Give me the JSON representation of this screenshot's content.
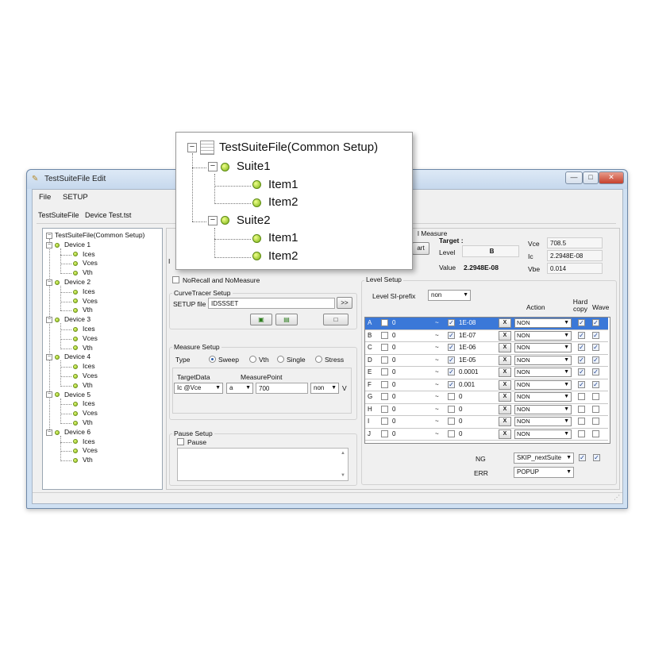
{
  "window": {
    "title": "TestSuiteFile Edit",
    "controls": {
      "minimize": "—",
      "maximize": "□",
      "close": "✕"
    }
  },
  "menu": [
    "File",
    "SETUP"
  ],
  "tabs": [
    "TestSuiteFile",
    "Device Test.tst"
  ],
  "tree": {
    "root": "TestSuiteFile(Common Setup)",
    "devices": [
      {
        "label": "Device 1",
        "items": [
          "Ices",
          "Vces",
          "Vth"
        ]
      },
      {
        "label": "Device 2",
        "items": [
          "Ices",
          "Vces",
          "Vth"
        ]
      },
      {
        "label": "Device 3",
        "items": [
          "Ices",
          "Vces",
          "Vth"
        ]
      },
      {
        "label": "Device 4",
        "items": [
          "Ices",
          "Vces",
          "Vth"
        ]
      },
      {
        "label": "Device 5",
        "items": [
          "Ices",
          "Vces",
          "Vth"
        ]
      },
      {
        "label": "Device 6",
        "items": [
          "Ices",
          "Vces",
          "Vth"
        ]
      }
    ]
  },
  "overlay_tree": {
    "root": "TestSuiteFile(Common Setup)",
    "suites": [
      {
        "label": "Suite1",
        "items": [
          "Item1",
          "Item2"
        ]
      },
      {
        "label": "Suite2",
        "items": [
          "Item1",
          "Item2"
        ]
      }
    ]
  },
  "measure": {
    "group_title": "l Measure",
    "start_label": "art",
    "partial_label": "I",
    "target_label": "Target :",
    "level_label": "Level",
    "level_value": "B",
    "value_label": "Value",
    "value": "2.2948E-08",
    "vce_label": "Vce",
    "vce_value": "708.5",
    "ic_label": "Ic",
    "ic_value": "2.2948E-08",
    "vbe_label": "Vbe",
    "vbe_value": "0.014"
  },
  "norecall_label": "NoRecall and NoMeasure",
  "curve_tracer": {
    "title": "CurveTracer Setup",
    "setup_file_label": "SETUP file",
    "setup_file_value": "IDSSSET",
    "browse": ">>"
  },
  "measure_setup": {
    "title": "Measure Setup",
    "type_label": "Type",
    "types": [
      "Sweep",
      "Vth",
      "Single",
      "Stress"
    ],
    "selected_type": "Sweep",
    "target_data_label": "TargetData",
    "target_data_value": "Ic @Vce",
    "measure_point_label": "MeasurePoint",
    "measure_point_unit": "a",
    "measure_point_value": "700",
    "prefix_value": "non",
    "unit": "V"
  },
  "pause_setup": {
    "title": "Pause Setup",
    "pause_label": "Pause"
  },
  "level_setup": {
    "title": "Level Setup",
    "si_prefix_label": "Level SI-prefix",
    "si_prefix_value": "non",
    "headers": {
      "action": "Action",
      "hard_copy": "Hard copy",
      "wave": "Wave"
    },
    "tilde": "~",
    "x_label": "X",
    "rows": [
      {
        "level": "A",
        "low": "0",
        "high_checked": true,
        "high": "1E-08",
        "action": "NON",
        "hard": true,
        "wave": true,
        "selected": true
      },
      {
        "level": "B",
        "low": "0",
        "high_checked": true,
        "high": "1E-07",
        "action": "NON",
        "hard": true,
        "wave": true,
        "selected": false
      },
      {
        "level": "C",
        "low": "0",
        "high_checked": true,
        "high": "1E-06",
        "action": "NON",
        "hard": true,
        "wave": true,
        "selected": false
      },
      {
        "level": "D",
        "low": "0",
        "high_checked": true,
        "high": "1E-05",
        "action": "NON",
        "hard": true,
        "wave": true,
        "selected": false
      },
      {
        "level": "E",
        "low": "0",
        "high_checked": true,
        "high": "0.0001",
        "action": "NON",
        "hard": true,
        "wave": true,
        "selected": false
      },
      {
        "level": "F",
        "low": "0",
        "high_checked": true,
        "high": "0.001",
        "action": "NON",
        "hard": true,
        "wave": true,
        "selected": false
      },
      {
        "level": "G",
        "low": "0",
        "high_checked": false,
        "high": "0",
        "action": "NON",
        "hard": false,
        "wave": false,
        "selected": false
      },
      {
        "level": "H",
        "low": "0",
        "high_checked": false,
        "high": "0",
        "action": "NON",
        "hard": false,
        "wave": false,
        "selected": false
      },
      {
        "level": "I",
        "low": "0",
        "high_checked": false,
        "high": "0",
        "action": "NON",
        "hard": false,
        "wave": false,
        "selected": false
      },
      {
        "level": "J",
        "low": "0",
        "high_checked": false,
        "high": "0",
        "action": "NON",
        "hard": false,
        "wave": false,
        "selected": false
      }
    ],
    "ng_label": "NG",
    "ng_value": "SKIP_nextSuite",
    "err_label": "ERR",
    "err_value": "POPUP"
  },
  "colors": {
    "selection": "#3b78d8",
    "window_border": "#6d88a8",
    "node_dot": "#7fb21a"
  }
}
